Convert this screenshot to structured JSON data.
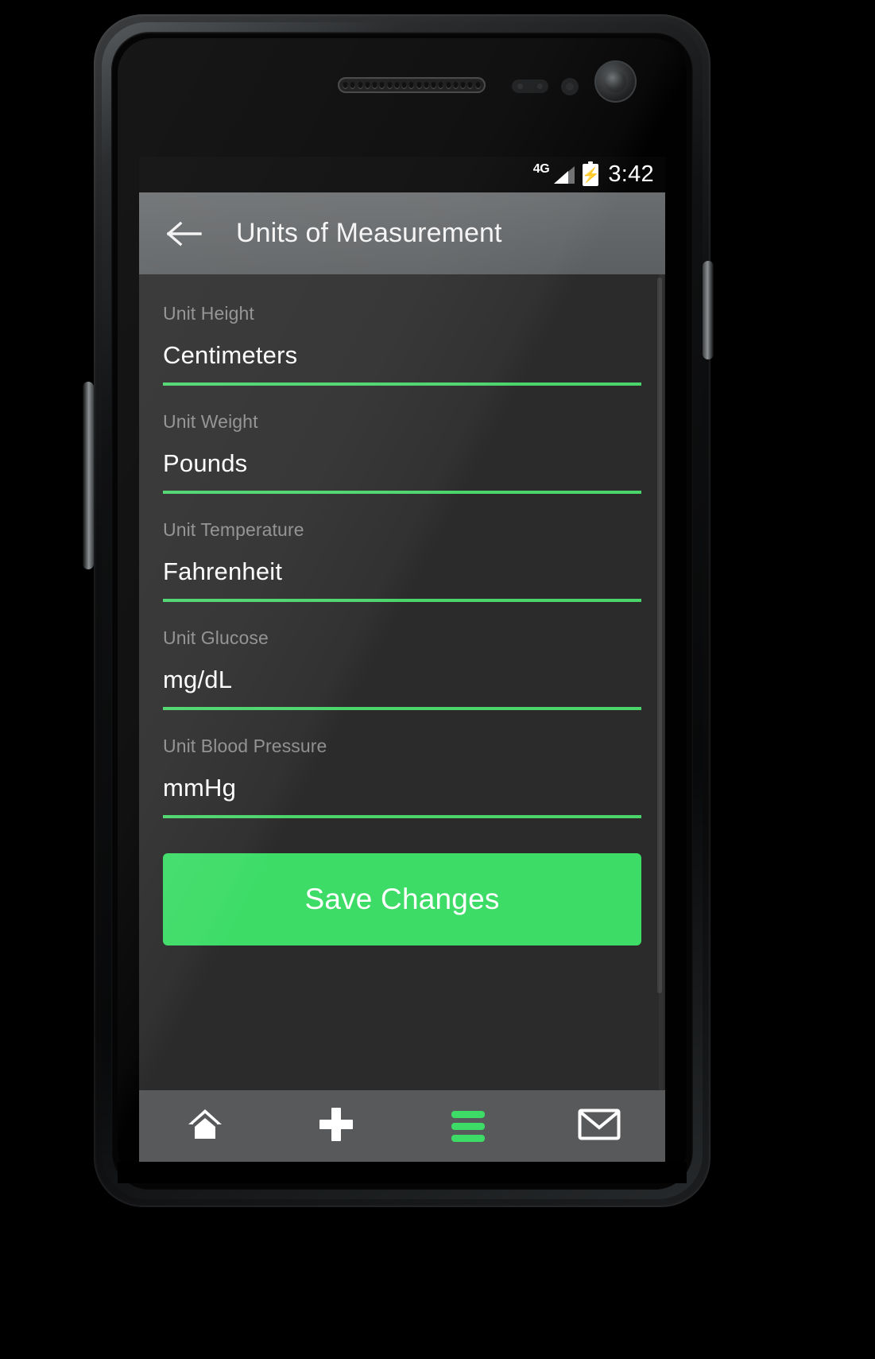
{
  "device": {
    "name": "android-phone",
    "speaker_grille_dots": 19
  },
  "status_bar": {
    "network_label": "4G",
    "battery_icon": "battery-charging-icon",
    "signal_icon": "signal-bars-icon",
    "time": "3:42"
  },
  "action_bar": {
    "back_icon": "back-arrow-icon",
    "title": "Units of Measurement"
  },
  "form": {
    "fields": [
      {
        "label": "Unit Height",
        "value": "Centimeters"
      },
      {
        "label": "Unit Weight",
        "value": "Pounds"
      },
      {
        "label": "Unit Temperature",
        "value": "Fahrenheit"
      },
      {
        "label": "Unit Glucose",
        "value": "mg/dL"
      },
      {
        "label": "Unit Blood Pressure",
        "value": "mmHg"
      }
    ],
    "save_label": "Save Changes"
  },
  "bottom_nav": {
    "items": [
      {
        "icon": "home-icon",
        "active": false
      },
      {
        "icon": "plus-icon",
        "active": false
      },
      {
        "icon": "hamburger-icon",
        "active": true
      },
      {
        "icon": "envelope-icon",
        "active": false
      }
    ]
  },
  "colors": {
    "accent_green": "#3ddc67",
    "underline_green": "#4ad46b",
    "screen_bg": "#2b2b2b",
    "action_bar_bg": "#636668",
    "nav_bg": "#58595b",
    "label_gray": "#8e8e8e",
    "value_white": "#fdfdfd"
  }
}
